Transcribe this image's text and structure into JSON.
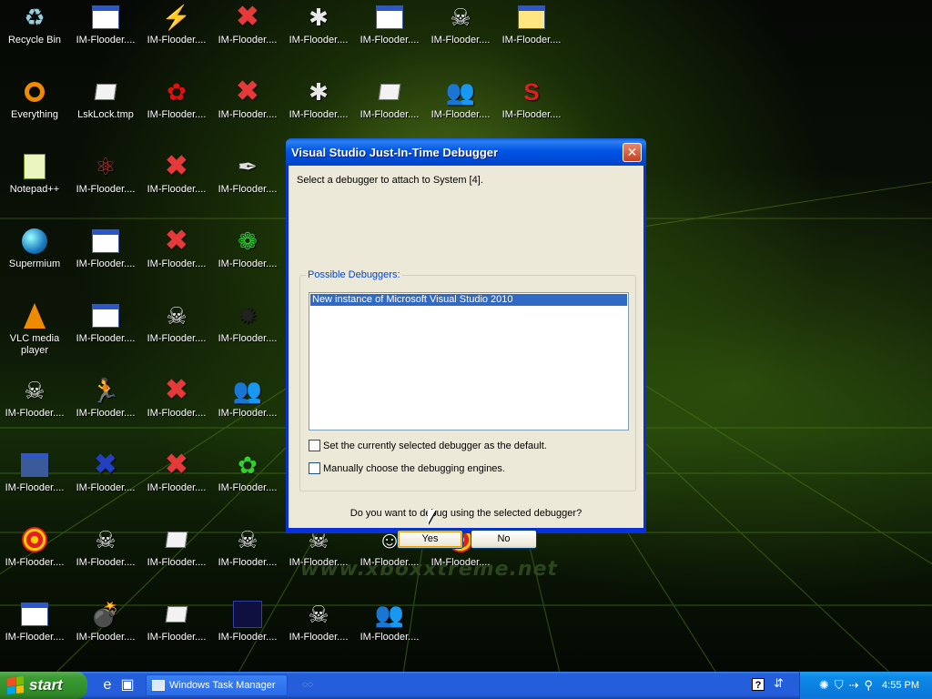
{
  "watermark": "www.xboxxtreme.net",
  "desktop_icons": [
    {
      "label": "Recycle Bin",
      "icon": "recycle-bin-icon"
    },
    {
      "label": "IM-Flooder....",
      "icon": "window-icon"
    },
    {
      "label": "IM-Flooder....",
      "icon": "lightning-icon"
    },
    {
      "label": "IM-Flooder....",
      "icon": "red-x-icon"
    },
    {
      "label": "IM-Flooder....",
      "icon": "white-star-icon"
    },
    {
      "label": "IM-Flooder....",
      "icon": "window-icon"
    },
    {
      "label": "IM-Flooder....",
      "icon": "skull-icon"
    },
    {
      "label": "IM-Flooder....",
      "icon": "application-icon"
    },
    {
      "label": "Everything",
      "icon": "everything-icon"
    },
    {
      "label": "LskLock.tmp",
      "icon": "document-icon"
    },
    {
      "label": "IM-Flooder....",
      "icon": "red-flower-icon"
    },
    {
      "label": "IM-Flooder....",
      "icon": "red-x-icon"
    },
    {
      "label": "IM-Flooder....",
      "icon": "white-star-icon"
    },
    {
      "label": "IM-Flooder....",
      "icon": "document-icon"
    },
    {
      "label": "IM-Flooder....",
      "icon": "people-icon"
    },
    {
      "label": "IM-Flooder....",
      "icon": "superman-icon"
    },
    {
      "label": "Notepad++",
      "icon": "notepad-icon"
    },
    {
      "label": "IM-Flooder....",
      "icon": "atom-icon"
    },
    {
      "label": "IM-Flooder....",
      "icon": "red-x-icon"
    },
    {
      "label": "IM-Flooder....",
      "icon": "feather-icon"
    },
    {
      "label": "Supermium",
      "icon": "globe-icon"
    },
    {
      "label": "IM-Flooder....",
      "icon": "window-icon"
    },
    {
      "label": "IM-Flooder....",
      "icon": "red-x-icon"
    },
    {
      "label": "IM-Flooder....",
      "icon": "dfm-flower-icon"
    },
    {
      "label": "VLC media player",
      "icon": "vlc-cone-icon"
    },
    {
      "label": "IM-Flooder....",
      "icon": "window-icon"
    },
    {
      "label": "IM-Flooder....",
      "icon": "skull-icon"
    },
    {
      "label": "IM-Flooder....",
      "icon": "black-star-icon"
    },
    {
      "label": "IM-Flooder....",
      "icon": "skull-icon"
    },
    {
      "label": "IM-Flooder....",
      "icon": "running-man-icon"
    },
    {
      "label": "IM-Flooder....",
      "icon": "red-x-icon"
    },
    {
      "label": "IM-Flooder....",
      "icon": "people-icon"
    },
    {
      "label": "IM-Flooder....",
      "icon": "picture-icon"
    },
    {
      "label": "IM-Flooder....",
      "icon": "crossed-x-icon"
    },
    {
      "label": "IM-Flooder....",
      "icon": "red-x-icon"
    },
    {
      "label": "IM-Flooder....",
      "icon": "green-flower-icon"
    },
    {
      "label": "IM-Flooder....",
      "icon": "target-icon"
    },
    {
      "label": "IM-Flooder....",
      "icon": "skull-icon"
    },
    {
      "label": "IM-Flooder....",
      "icon": "document-icon"
    },
    {
      "label": "IM-Flooder....",
      "icon": "skull-icon"
    },
    {
      "label": "IM-Flooder....",
      "icon": "skull-icon"
    },
    {
      "label": "IM-Flooder....",
      "icon": "smiley-icon"
    },
    {
      "label": "IM-Flooder....",
      "icon": "target-icon"
    },
    {
      "label": "IM-Flooder....",
      "icon": "window-icon"
    },
    {
      "label": "IM-Flooder....",
      "icon": "bomb-icon"
    },
    {
      "label": "IM-Flooder....",
      "icon": "document-icon"
    },
    {
      "label": "IM-Flooder....",
      "icon": "blue-square-icon"
    },
    {
      "label": "IM-Flooder....",
      "icon": "skull-icon"
    },
    {
      "label": "IM-Flooder....",
      "icon": "people-icon"
    }
  ],
  "dialog": {
    "title": "Visual Studio Just-In-Time Debugger",
    "close_label": "✕",
    "prompt": "Select a debugger to attach to System [4].",
    "group_label": "Possible Debuggers:",
    "debuggers": [
      "New instance of Microsoft Visual Studio 2010"
    ],
    "checkbox_default": {
      "label": "Set the currently selected debugger as the default.",
      "checked": false
    },
    "checkbox_engines": {
      "label": "Manually choose the debugging engines.",
      "checked": false
    },
    "question": "Do you want to debug using the selected debugger?",
    "yes_label": "Yes",
    "no_label": "No"
  },
  "taskbar": {
    "start_label": "start",
    "task_button_label": "Windows Task Manager",
    "clock": "4:55 PM"
  },
  "colors": {
    "titlebar": "#0055e5",
    "selection": "#316ac5",
    "taskbar": "#245edb",
    "start": "#3c9c34"
  }
}
